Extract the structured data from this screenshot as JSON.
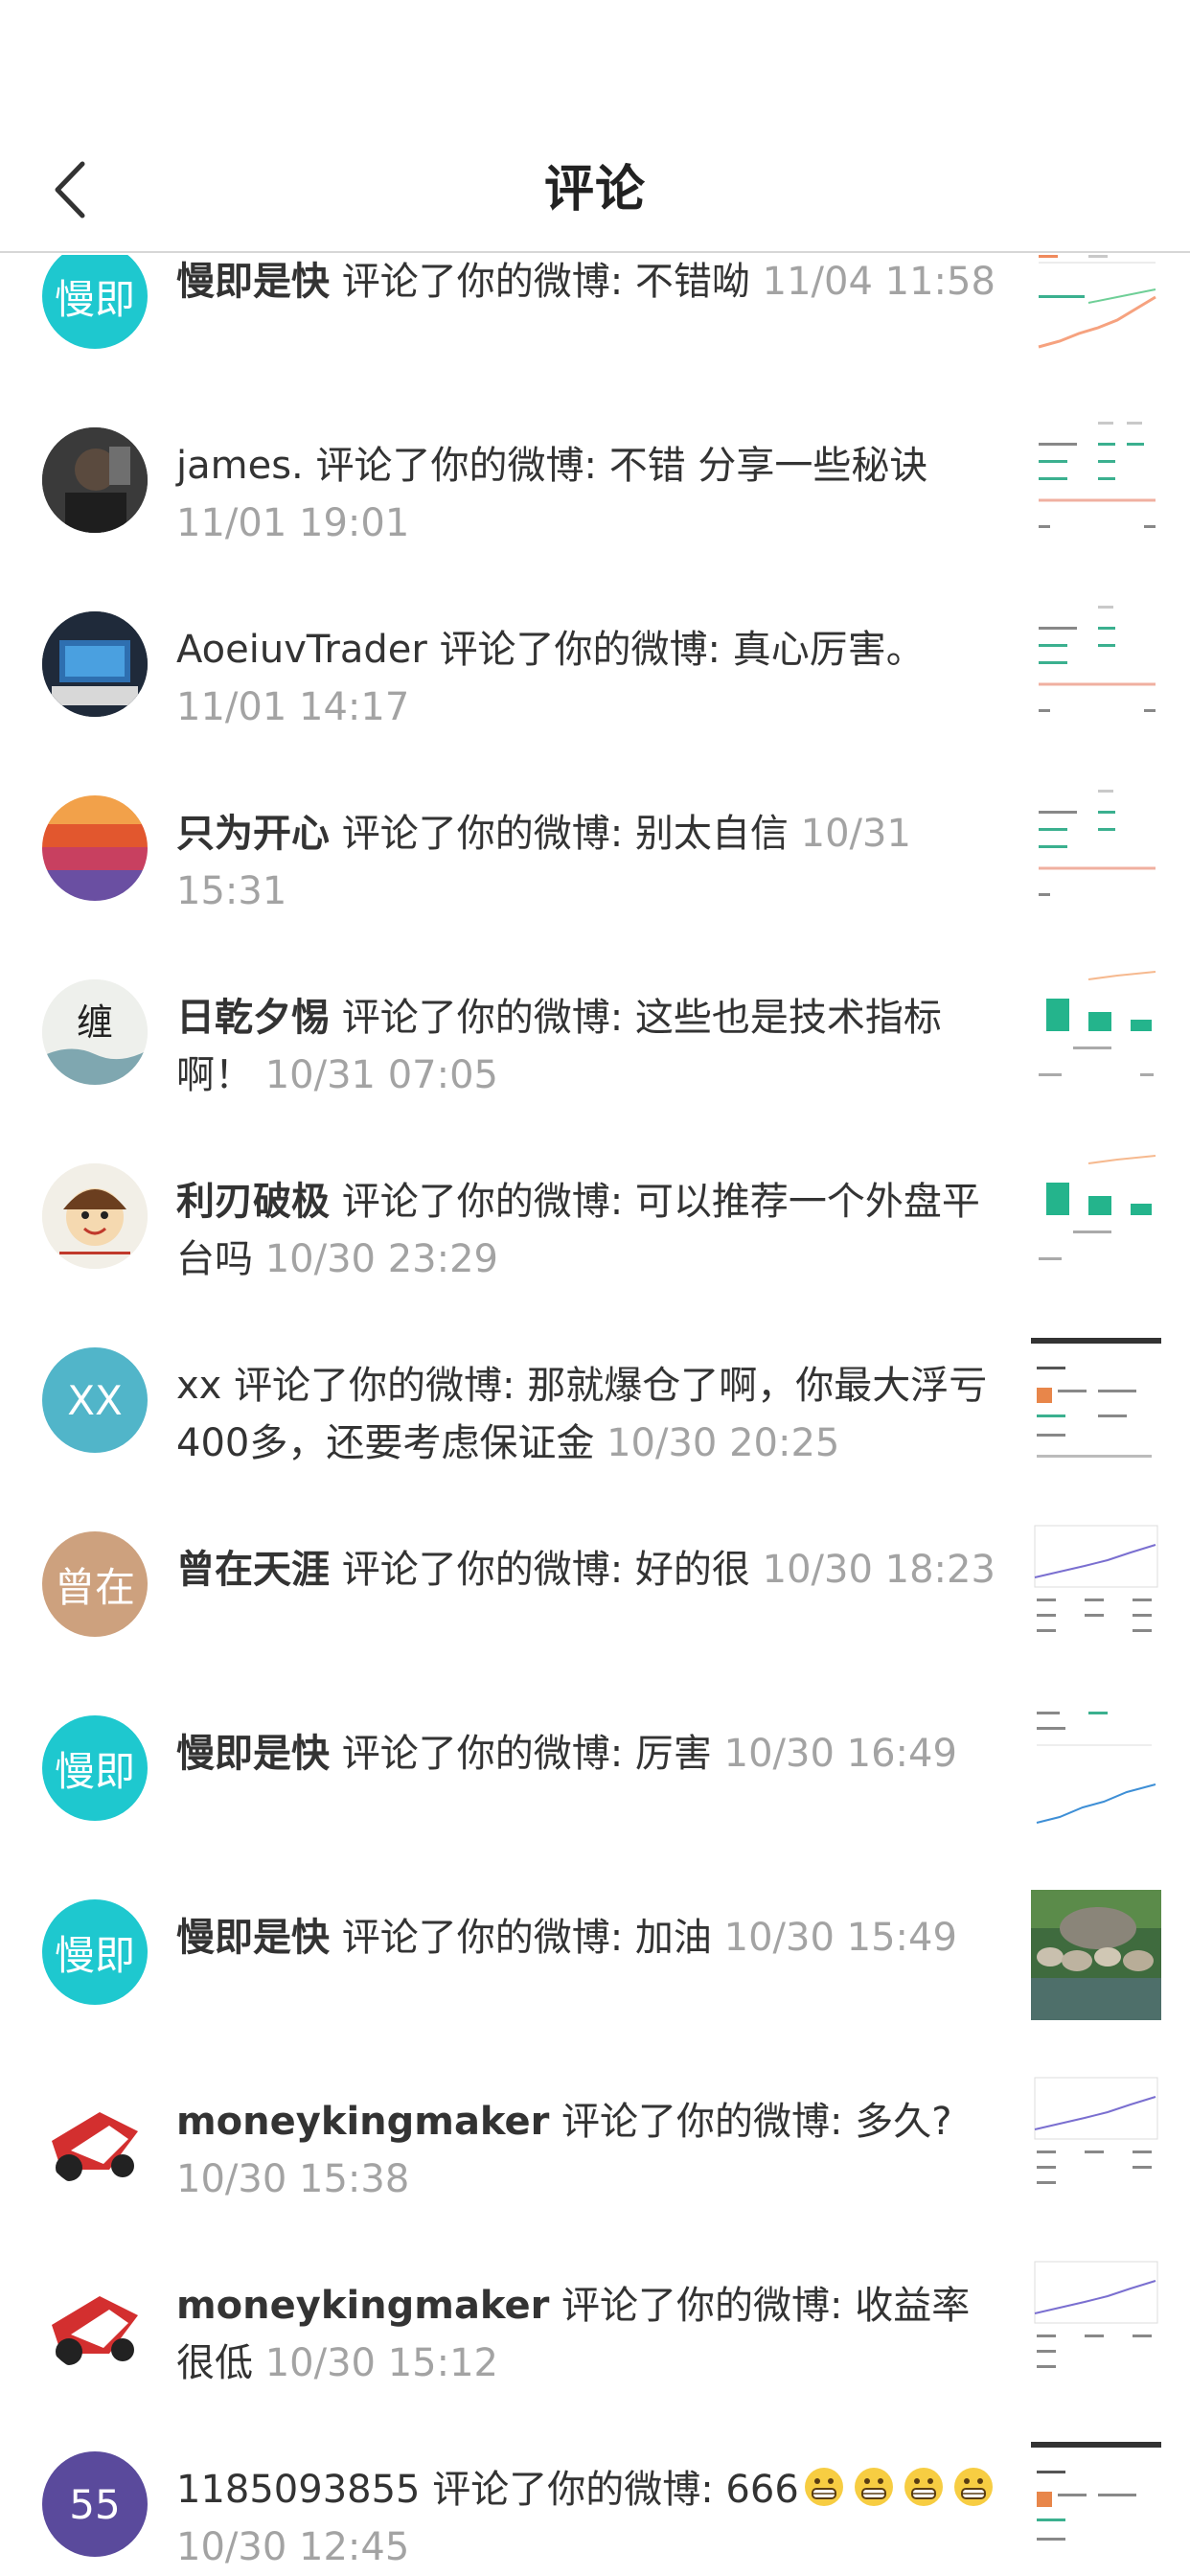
{
  "header": {
    "title": "评论"
  },
  "colors": {
    "teal_avatar": "#1ec8cf",
    "blue_avatar": "#51b5c9",
    "tan_avatar": "#cda17e",
    "purple_avatar": "#5a4a9c",
    "timestamp": "#a3a3a3"
  },
  "comments": [
    {
      "user": "慢即是快",
      "avatar_text": "慢即",
      "action": "评论了你的微博:",
      "text": "不错呦",
      "time": "11/04 11:58"
    },
    {
      "user": "james.",
      "avatar_text": "",
      "action": "评论了你的微博:",
      "text": "不错 分享一些秘诀",
      "time": "11/01 19:01"
    },
    {
      "user": "AoeiuvTrader",
      "avatar_text": "",
      "action": "评论了你的微博:",
      "text": "真心厉害。",
      "time": "11/01 14:17"
    },
    {
      "user": "只为开心",
      "avatar_text": "",
      "action": "评论了你的微博:",
      "text": "别太自信",
      "time": "10/31 15:31"
    },
    {
      "user": "日乾夕惕",
      "avatar_text": "缠",
      "action": "评论了你的微博:",
      "text": "这些也是技术指标啊！",
      "time": "10/31 07:05"
    },
    {
      "user": "利刃破极",
      "avatar_text": "",
      "action": "评论了你的微博:",
      "text": "可以推荐一个外盘平台吗",
      "time": "10/30 23:29"
    },
    {
      "user": "xx",
      "avatar_text": "XX",
      "action": "评论了你的微博:",
      "text": "那就爆仓了啊，你最大浮亏400多，还要考虑保证金",
      "time": "10/30 20:25"
    },
    {
      "user": "曾在天涯",
      "avatar_text": "曾在",
      "action": "评论了你的微博:",
      "text": "好的很",
      "time": "10/30 18:23"
    },
    {
      "user": "慢即是快",
      "avatar_text": "慢即",
      "action": "评论了你的微博:",
      "text": "厉害",
      "time": "10/30 16:49"
    },
    {
      "user": "慢即是快",
      "avatar_text": "慢即",
      "action": "评论了你的微博:",
      "text": "加油",
      "time": "10/30 15:49"
    },
    {
      "user": "moneykingmaker",
      "avatar_text": "",
      "action": "评论了你的微博:",
      "text": "多久?",
      "time": "10/30 15:38"
    },
    {
      "user": "moneykingmaker",
      "avatar_text": "",
      "action": "评论了你的微博:",
      "text": "收益率很低",
      "time": "10/30 15:12"
    },
    {
      "user": "1185093855",
      "avatar_text": "55",
      "action": "评论了你的微博:",
      "text": "666",
      "time": "10/30 12:45"
    }
  ]
}
